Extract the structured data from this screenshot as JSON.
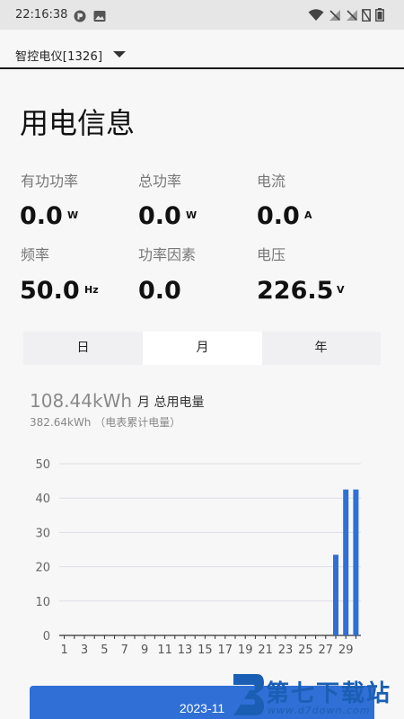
{
  "status_bar": {
    "time": "22:16:38",
    "left_icons": [
      "app-notification-icon",
      "image-icon"
    ],
    "right_icons": [
      "wifi-icon",
      "no-signal-icon",
      "no-signal-icon",
      "no-sim-icon",
      "battery-icon"
    ]
  },
  "device": {
    "name": "智控电仪[1326]"
  },
  "page_title": "用电信息",
  "metrics": [
    {
      "label": "有功功率",
      "value": "0.0",
      "unit": "W"
    },
    {
      "label": "总功率",
      "value": "0.0",
      "unit": "W"
    },
    {
      "label": "电流",
      "value": "0.0",
      "unit": "A"
    },
    {
      "label": "频率",
      "value": "50.0",
      "unit": "Hz"
    },
    {
      "label": "功率因素",
      "value": "0.0",
      "unit": ""
    },
    {
      "label": "电压",
      "value": "226.5",
      "unit": "V"
    }
  ],
  "tabs": [
    {
      "label": "日",
      "active": false
    },
    {
      "label": "月",
      "active": true
    },
    {
      "label": "年",
      "active": false
    }
  ],
  "summary": {
    "total": "108.44kWh",
    "caption": "月 总用电量",
    "meter": "382.64kWh （电表累计电量）"
  },
  "chart_data": {
    "type": "bar",
    "x": [
      1,
      2,
      3,
      4,
      5,
      6,
      7,
      8,
      9,
      10,
      11,
      12,
      13,
      14,
      15,
      16,
      17,
      18,
      19,
      20,
      21,
      22,
      23,
      24,
      25,
      26,
      27,
      28,
      29,
      30
    ],
    "x_tick_labels": [
      "1",
      "3",
      "5",
      "7",
      "9",
      "11",
      "13",
      "15",
      "17",
      "19",
      "21",
      "23",
      "25",
      "27",
      "29"
    ],
    "values": [
      0,
      0,
      0,
      0,
      0,
      0,
      0,
      0,
      0,
      0,
      0,
      0,
      0,
      0,
      0,
      0,
      0,
      0,
      0,
      0,
      0,
      0,
      0,
      0,
      0,
      0,
      0,
      23.5,
      42.5,
      42.5
    ],
    "ylim": [
      0,
      50
    ],
    "y_ticks": [
      "0",
      "10",
      "20",
      "30",
      "40",
      "50"
    ],
    "grid": true,
    "bar_color": "#2f6fd6"
  },
  "bottom_button": {
    "label": "2023-11"
  },
  "watermark": {
    "text": "第七下载站",
    "url": "www.d7down.com"
  }
}
